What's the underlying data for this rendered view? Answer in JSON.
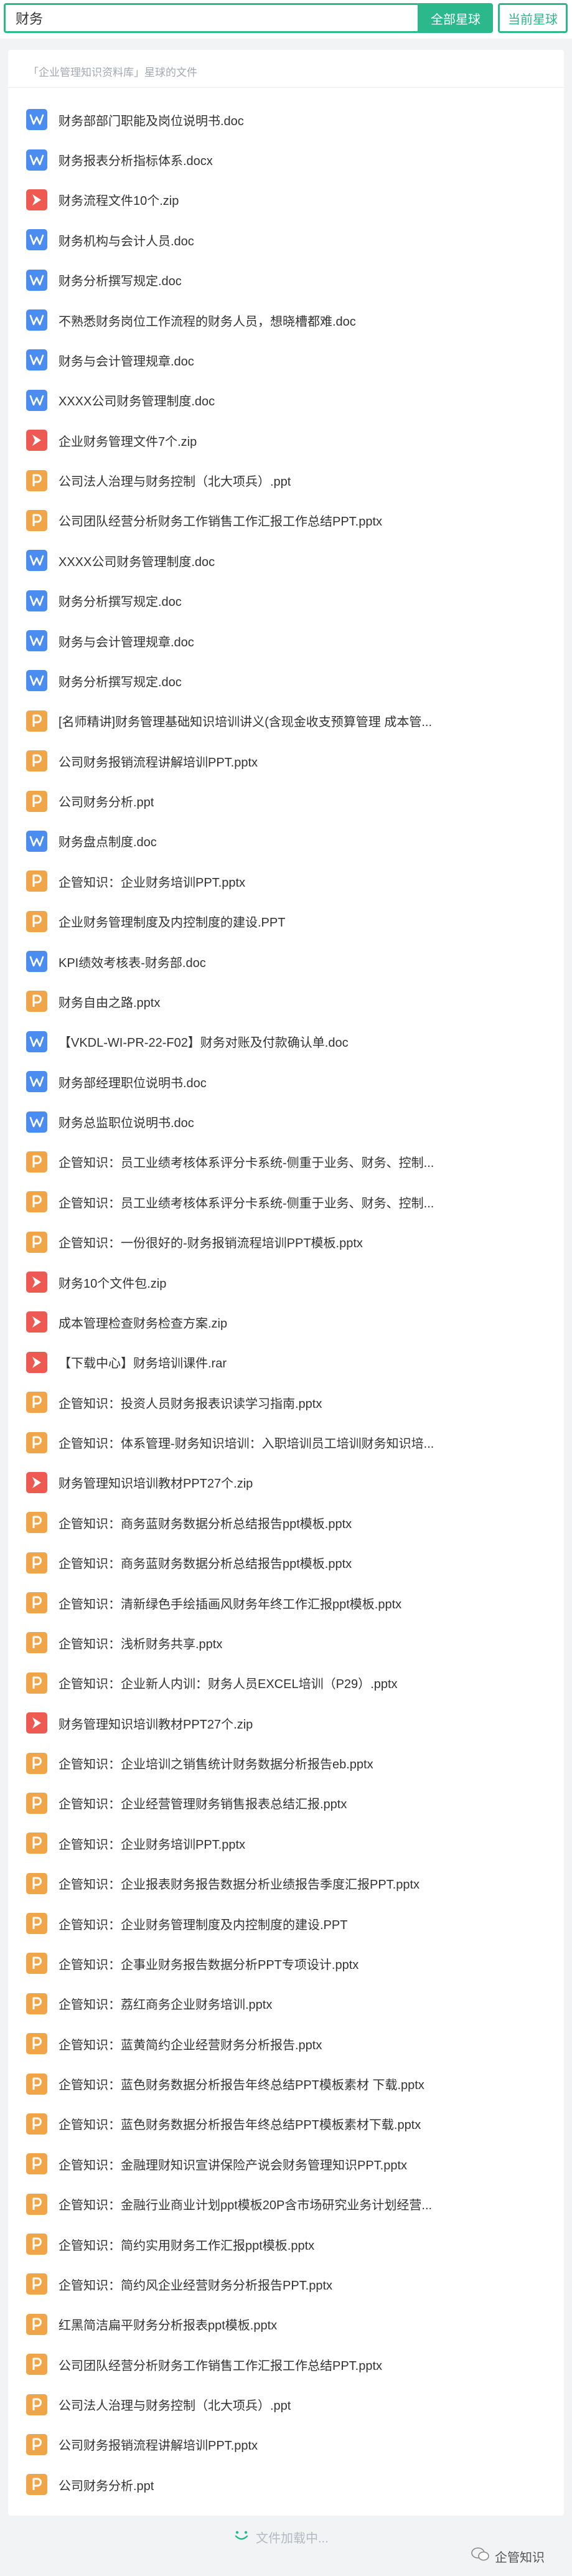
{
  "search": {
    "query": "财务",
    "all_button": "全部星球",
    "current_button": "当前星球"
  },
  "breadcrumb": "「企业管理知识资料库」星球的文件",
  "files": [
    {
      "name": "财务部部门职能及岗位说明书.doc",
      "type": "word"
    },
    {
      "name": "财务报表分析指标体系.docx",
      "type": "word"
    },
    {
      "name": "财务流程文件10个.zip",
      "type": "zip"
    },
    {
      "name": "财务机构与会计人员.doc",
      "type": "word"
    },
    {
      "name": "财务分析撰写规定.doc",
      "type": "word"
    },
    {
      "name": "不熟悉财务岗位工作流程的财务人员，想晓槽都难.doc",
      "type": "word"
    },
    {
      "name": "财务与会计管理规章.doc",
      "type": "word"
    },
    {
      "name": "XXXX公司财务管理制度.doc",
      "type": "word"
    },
    {
      "name": "企业财务管理文件7个.zip",
      "type": "zip"
    },
    {
      "name": "公司法人治理与财务控制（北大项兵）.ppt",
      "type": "ppt"
    },
    {
      "name": "公司团队经营分析财务工作销售工作汇报工作总结PPT.pptx",
      "type": "ppt"
    },
    {
      "name": "XXXX公司财务管理制度.doc",
      "type": "word"
    },
    {
      "name": "财务分析撰写规定.doc",
      "type": "word"
    },
    {
      "name": "财务与会计管理规章.doc",
      "type": "word"
    },
    {
      "name": "财务分析撰写规定.doc",
      "type": "word"
    },
    {
      "name": "[名师精讲]财务管理基础知识培训讲义(含现金收支预算管理 成本管...",
      "type": "ppt"
    },
    {
      "name": "公司财务报销流程讲解培训PPT.pptx",
      "type": "ppt"
    },
    {
      "name": "公司财务分析.ppt",
      "type": "ppt"
    },
    {
      "name": "财务盘点制度.doc",
      "type": "word"
    },
    {
      "name": "企管知识：企业财务培训PPT.pptx",
      "type": "ppt"
    },
    {
      "name": "企业财务管理制度及内控制度的建设.PPT",
      "type": "ppt"
    },
    {
      "name": "KPI绩效考核表-财务部.doc",
      "type": "word"
    },
    {
      "name": "财务自由之路.pptx",
      "type": "ppt"
    },
    {
      "name": "【VKDL-WI-PR-22-F02】财务对账及付款确认单.doc",
      "type": "word"
    },
    {
      "name": "财务部经理职位说明书.doc",
      "type": "word"
    },
    {
      "name": "财务总监职位说明书.doc",
      "type": "word"
    },
    {
      "name": "企管知识：员工业绩考核体系评分卡系统-侧重于业务、财务、控制...",
      "type": "ppt"
    },
    {
      "name": "企管知识：员工业绩考核体系评分卡系统-侧重于业务、财务、控制...",
      "type": "ppt"
    },
    {
      "name": "企管知识：一份很好的-财务报销流程培训PPT模板.pptx",
      "type": "ppt"
    },
    {
      "name": "财务10个文件包.zip",
      "type": "zip"
    },
    {
      "name": "成本管理检查财务检查方案.zip",
      "type": "zip"
    },
    {
      "name": "【下载中心】财务培训课件.rar",
      "type": "zip"
    },
    {
      "name": "企管知识：投资人员财务报表识读学习指南.pptx",
      "type": "ppt"
    },
    {
      "name": "企管知识：体系管理-财务知识培训：入职培训员工培训财务知识培...",
      "type": "ppt"
    },
    {
      "name": "财务管理知识培训教材PPT27个.zip",
      "type": "zip"
    },
    {
      "name": "企管知识：商务蓝财务数据分析总结报告ppt模板.pptx",
      "type": "ppt"
    },
    {
      "name": "企管知识：商务蓝财务数据分析总结报告ppt模板.pptx",
      "type": "ppt"
    },
    {
      "name": "企管知识：清新绿色手绘插画风财务年终工作汇报ppt模板.pptx",
      "type": "ppt"
    },
    {
      "name": "企管知识：浅析财务共享.pptx",
      "type": "ppt"
    },
    {
      "name": "企管知识：企业新人内训：财务人员EXCEL培训（P29）.pptx",
      "type": "ppt"
    },
    {
      "name": "财务管理知识培训教材PPT27个.zip",
      "type": "zip"
    },
    {
      "name": "企管知识：企业培训之销售统计财务数据分析报告eb.pptx",
      "type": "ppt"
    },
    {
      "name": "企管知识：企业经营管理财务销售报表总结汇报.pptx",
      "type": "ppt"
    },
    {
      "name": "企管知识：企业财务培训PPT.pptx",
      "type": "ppt"
    },
    {
      "name": "企管知识：企业报表财务报告数据分析业绩报告季度汇报PPT.pptx",
      "type": "ppt"
    },
    {
      "name": "企管知识：企业财务管理制度及内控制度的建设.PPT",
      "type": "ppt"
    },
    {
      "name": "企管知识：企事业财务报告数据分析PPT专项设计.pptx",
      "type": "ppt"
    },
    {
      "name": "企管知识：荔红商务企业财务培训.pptx",
      "type": "ppt"
    },
    {
      "name": "企管知识：蓝黄简约企业经营财务分析报告.pptx",
      "type": "ppt"
    },
    {
      "name": "企管知识：蓝色财务数据分析报告年终总结PPT模板素材 下载.pptx",
      "type": "ppt"
    },
    {
      "name": "企管知识：蓝色财务数据分析报告年终总结PPT模板素材下载.pptx",
      "type": "ppt"
    },
    {
      "name": "企管知识：金融理财知识宣讲保险产说会财务管理知识PPT.pptx",
      "type": "ppt"
    },
    {
      "name": "企管知识：金融行业商业计划ppt模板20P含市场研究业务计划经营...",
      "type": "ppt"
    },
    {
      "name": "企管知识：简约实用财务工作汇报ppt模板.pptx",
      "type": "ppt"
    },
    {
      "name": "企管知识：简约风企业经营财务分析报告PPT.pptx",
      "type": "ppt"
    },
    {
      "name": "红黑简洁扁平财务分析报表ppt模板.pptx",
      "type": "ppt"
    },
    {
      "name": "公司团队经营分析财务工作销售工作汇报工作总结PPT.pptx",
      "type": "ppt"
    },
    {
      "name": "公司法人治理与财务控制（北大项兵）.ppt",
      "type": "ppt"
    },
    {
      "name": "公司财务报销流程讲解培训PPT.pptx",
      "type": "ppt"
    },
    {
      "name": "公司财务分析.ppt",
      "type": "ppt"
    }
  ],
  "footer": {
    "loading_text": "文件加载中...",
    "brand": "企管知识"
  },
  "colors": {
    "accent": "#2bb88a",
    "word_icon": "#4a8cf0",
    "ppt_icon": "#f0a548",
    "zip_icon": "#ee5a52"
  },
  "icons": {
    "word": "word-file-icon",
    "ppt": "ppt-file-icon",
    "zip": "zip-file-icon",
    "loading": "smile-loading-icon",
    "brand": "wechat-brand-icon"
  }
}
